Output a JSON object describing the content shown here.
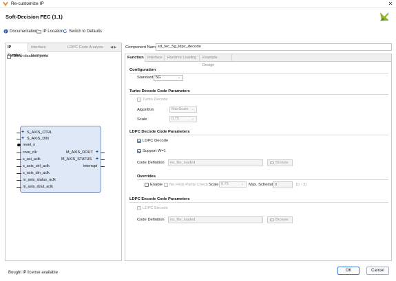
{
  "window": {
    "title": "Re-customize IP"
  },
  "header": {
    "ip_title": "Soft-Decision FEC (1.1)"
  },
  "toolbar": {
    "documentation": "Documentation",
    "ip_location": "IP Location",
    "switch_defaults": "Switch to Defaults"
  },
  "left_panel": {
    "tabs": [
      "IP Symbol",
      "Interface Summary",
      "LDPC Code Analysis"
    ],
    "show_disabled_ports": "Show disabled ports",
    "left_ports": [
      "S_AXIS_CTRL",
      "S_AXIS_DIN",
      "reset_n",
      "core_clk",
      "s_axi_aclk",
      "s_axis_ctrl_aclk",
      "s_axis_din_aclk",
      "m_axis_status_aclk",
      "m_axis_dout_aclk"
    ],
    "right_ports": [
      "M_AXIS_DOUT",
      "M_AXIS_STATUS",
      "interrupt"
    ]
  },
  "component": {
    "label": "Component Name",
    "value": "sd_fec_5g_ldpc_decode"
  },
  "right_tabs": [
    "Function",
    "Interface",
    "Runtime Loading",
    "Example Design"
  ],
  "configuration": {
    "title": "Configuration",
    "standard_label": "Standard",
    "standard_value": "5G"
  },
  "turbo": {
    "title": "Turbo Decode Code Parameters",
    "turbo_decode": "Turbo Decode",
    "algorithm_label": "Algorithm",
    "algorithm_value": "MaxScale",
    "scale_label": "Scale",
    "scale_value": "0.75"
  },
  "ldpc_decode": {
    "title": "LDPC Decode Code Parameters",
    "ldpc_decode": "LDPC Decode",
    "support_w": "Support W=1",
    "code_def_label": "Code Definition",
    "code_def_value": "no_file_loaded",
    "browse": "Browse"
  },
  "overrides": {
    "title": "Overrides",
    "enable": "Enable",
    "no_final_parity": "No Final Parity Check",
    "scale_label": "Scale",
    "scale_value": "0.75",
    "max_schedule_label": "Max. Schedule",
    "max_schedule_value": "0",
    "range": "[0 - 3]"
  },
  "ldpc_encode": {
    "title": "LDPC Encode Code Parameters",
    "ldpc_encode": "LDPC Encode",
    "code_def_label": "Code Definition",
    "code_def_value": "no_file_loaded",
    "browse": "Browse"
  },
  "footer": {
    "status": "Bought IP license available",
    "ok": "OK",
    "cancel": "Cancel"
  },
  "colors": {
    "accent": "#1a5fb4",
    "ip_block_fill": "#dfe8f7",
    "ip_block_border": "#7f96c2"
  }
}
